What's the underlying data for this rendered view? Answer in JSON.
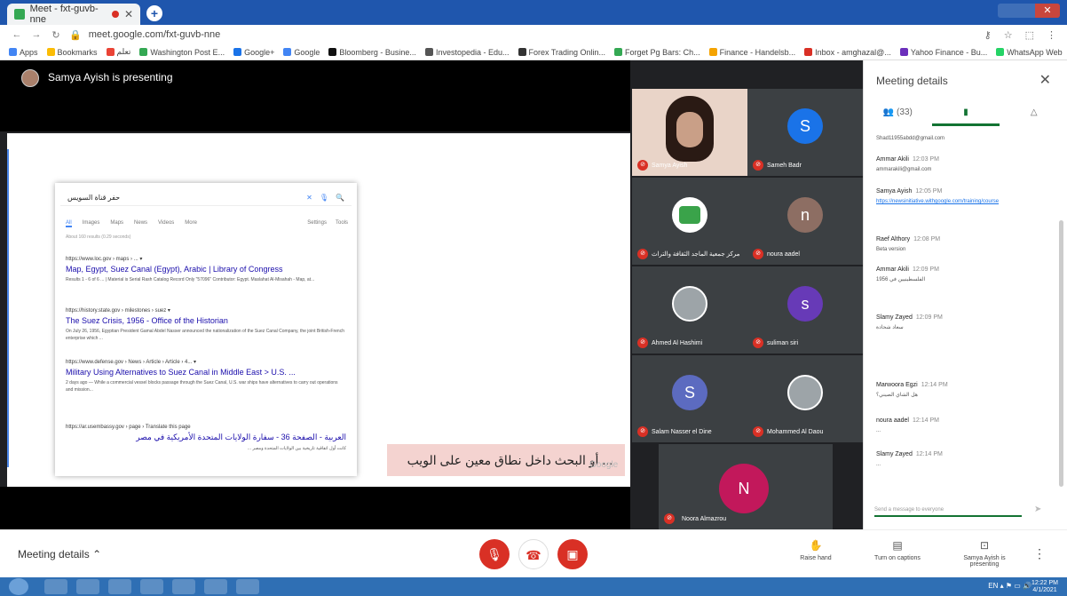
{
  "browser": {
    "tab_title": "Meet - fxt-guvb-nne",
    "url": "meet.google.com/fxt-guvb-nne",
    "bookmarks": [
      "Apps",
      "Bookmarks",
      "تعلم",
      "Washington Post E...",
      "Google+",
      "Google",
      "Bloomberg - Busine...",
      "Investopedia - Edu...",
      "Forex Trading Onlin...",
      "Forget Pg Bars: Ch...",
      "Finance - Handelsb...",
      "Inbox - amghazal@...",
      "Yahoo Finance - Bu...",
      "WhatsApp Web",
      "Other bookmarks"
    ]
  },
  "meet": {
    "presenter_label": "Samya Ayish is presenting"
  },
  "share": {
    "search_query": "حفر قناة السويس",
    "nav": [
      "All",
      "Images",
      "Maps",
      "News",
      "Videos",
      "More"
    ],
    "nav_right": [
      "Settings",
      "Tools"
    ],
    "stats": "About 160 results (0.29 seconds)",
    "results": [
      {
        "url": "https://www.loc.gov › maps › ... ▾",
        "title": "Map, Egypt, Suez Canal (Egypt), Arabic | Library of Congress",
        "snippet": "Results 1 - 6 of 6 ... | Material is Serial Rash Catalog Record Only \"57096\" Contributor: Egypt. Maslahat Al-Misahah - Map, at..."
      },
      {
        "url": "https://history.state.gov › milestones › suez ▾",
        "title": "The Suez Crisis, 1956 - Office of the Historian",
        "snippet": "On July 26, 1956, Egyptian President Gamal Abdel Nasser announced the nationalization of the Suez Canal Company, the joint British-French enterprise which ..."
      },
      {
        "url": "https://www.defense.gov › News › Article › Article › 4... ▾",
        "title": "Military Using Alternatives to Suez Canal in Middle East > U.S. ...",
        "snippet": "2 days ago — While a commercial vessel blocks passage through the Suez Canal, U.S. war ships have alternatives to carry out operations and mission..."
      },
      {
        "url": "https://ar.usembassy.gov › page › Translate this page",
        "title": "العربية - الصفحة 36 - سفارة الولايات المتحدة الأمريكية في مصر",
        "snippet": "كانت أول اتفاقية تاريخية بين الولايات المتحدة ومصر ..."
      }
    ],
    "watermark": "Google",
    "caption": "... أو البحث داخل نطاق معين على الويب"
  },
  "participants": [
    {
      "name": "Samya Ayish",
      "type": "video"
    },
    {
      "name": "Sameh Badr",
      "initial": "S",
      "color": "#1a73e8",
      "type": "initial"
    },
    {
      "name": "مركز جمعية الماجد الثقافة والتراث",
      "type": "logo"
    },
    {
      "name": "noura aadel",
      "initial": "n",
      "color": "#8d6e63",
      "type": "initial"
    },
    {
      "name": "Ahmed Al Hashimi",
      "type": "photo"
    },
    {
      "name": "suliman siri",
      "initial": "s",
      "color": "#673ab7",
      "type": "initial"
    },
    {
      "name": "Salam Nasser el Dine",
      "initial": "S",
      "color": "#5c6bc0",
      "type": "initial"
    },
    {
      "name": "Mohammed Al Daou",
      "type": "photo"
    },
    {
      "name": "Noora Almazrou",
      "initial": "N",
      "color": "#c2185b",
      "type": "initial"
    }
  ],
  "panel": {
    "title": "Meeting details",
    "tabs": [
      "(33)",
      "chat",
      "activities"
    ],
    "messages": [
      {
        "name": "",
        "time": "",
        "body": "Shad11955abdd@gmail.com"
      },
      {
        "name": "Ammar Akili",
        "time": "12:03 PM",
        "body": "ammarakili@gmail.com"
      },
      {
        "name": "Samya Ayish",
        "time": "12:05 PM",
        "body": "https://newsinitiative.withgoogle.com/training/course",
        "link": true
      },
      {
        "name": "Raef Althory",
        "time": "12:08 PM",
        "body": "Beta version"
      },
      {
        "name": "Ammar Akili",
        "time": "12:09 PM",
        "body": "الفلسطينيين في 1956"
      },
      {
        "name": "Slamy Zayed",
        "time": "12:09 PM",
        "body": "سعاد شحادة"
      },
      {
        "name": "Marwoora Egzi",
        "time": "12:14 PM",
        "body": "هل الشاي الصيني؟"
      },
      {
        "name": "noura aadel",
        "time": "12:14 PM",
        "body": "..."
      },
      {
        "name": "Slamy Zayed",
        "time": "12:14 PM",
        "body": "..."
      }
    ],
    "input_placeholder": "Send a message to everyone"
  },
  "bottombar": {
    "meeting_details": "Meeting details",
    "raise_hand": "Raise hand",
    "captions": "Turn on captions",
    "presenting": "Samya Ayish is presenting"
  },
  "taskbar": {
    "clock_time": "12:22 PM",
    "clock_date": "4/1/2021"
  }
}
